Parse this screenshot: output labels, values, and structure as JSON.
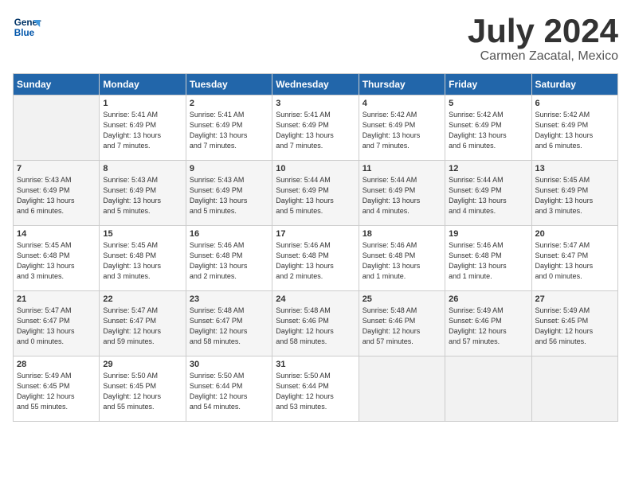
{
  "header": {
    "logo_line1": "General",
    "logo_line2": "Blue",
    "title": "July 2024",
    "subtitle": "Carmen Zacatal, Mexico"
  },
  "days_of_week": [
    "Sunday",
    "Monday",
    "Tuesday",
    "Wednesday",
    "Thursday",
    "Friday",
    "Saturday"
  ],
  "weeks": [
    [
      {
        "day": "",
        "info": ""
      },
      {
        "day": "1",
        "info": "Sunrise: 5:41 AM\nSunset: 6:49 PM\nDaylight: 13 hours\nand 7 minutes."
      },
      {
        "day": "2",
        "info": "Sunrise: 5:41 AM\nSunset: 6:49 PM\nDaylight: 13 hours\nand 7 minutes."
      },
      {
        "day": "3",
        "info": "Sunrise: 5:41 AM\nSunset: 6:49 PM\nDaylight: 13 hours\nand 7 minutes."
      },
      {
        "day": "4",
        "info": "Sunrise: 5:42 AM\nSunset: 6:49 PM\nDaylight: 13 hours\nand 7 minutes."
      },
      {
        "day": "5",
        "info": "Sunrise: 5:42 AM\nSunset: 6:49 PM\nDaylight: 13 hours\nand 6 minutes."
      },
      {
        "day": "6",
        "info": "Sunrise: 5:42 AM\nSunset: 6:49 PM\nDaylight: 13 hours\nand 6 minutes."
      }
    ],
    [
      {
        "day": "7",
        "info": "Sunrise: 5:43 AM\nSunset: 6:49 PM\nDaylight: 13 hours\nand 6 minutes."
      },
      {
        "day": "8",
        "info": "Sunrise: 5:43 AM\nSunset: 6:49 PM\nDaylight: 13 hours\nand 5 minutes."
      },
      {
        "day": "9",
        "info": "Sunrise: 5:43 AM\nSunset: 6:49 PM\nDaylight: 13 hours\nand 5 minutes."
      },
      {
        "day": "10",
        "info": "Sunrise: 5:44 AM\nSunset: 6:49 PM\nDaylight: 13 hours\nand 5 minutes."
      },
      {
        "day": "11",
        "info": "Sunrise: 5:44 AM\nSunset: 6:49 PM\nDaylight: 13 hours\nand 4 minutes."
      },
      {
        "day": "12",
        "info": "Sunrise: 5:44 AM\nSunset: 6:49 PM\nDaylight: 13 hours\nand 4 minutes."
      },
      {
        "day": "13",
        "info": "Sunrise: 5:45 AM\nSunset: 6:49 PM\nDaylight: 13 hours\nand 3 minutes."
      }
    ],
    [
      {
        "day": "14",
        "info": "Sunrise: 5:45 AM\nSunset: 6:48 PM\nDaylight: 13 hours\nand 3 minutes."
      },
      {
        "day": "15",
        "info": "Sunrise: 5:45 AM\nSunset: 6:48 PM\nDaylight: 13 hours\nand 3 minutes."
      },
      {
        "day": "16",
        "info": "Sunrise: 5:46 AM\nSunset: 6:48 PM\nDaylight: 13 hours\nand 2 minutes."
      },
      {
        "day": "17",
        "info": "Sunrise: 5:46 AM\nSunset: 6:48 PM\nDaylight: 13 hours\nand 2 minutes."
      },
      {
        "day": "18",
        "info": "Sunrise: 5:46 AM\nSunset: 6:48 PM\nDaylight: 13 hours\nand 1 minute."
      },
      {
        "day": "19",
        "info": "Sunrise: 5:46 AM\nSunset: 6:48 PM\nDaylight: 13 hours\nand 1 minute."
      },
      {
        "day": "20",
        "info": "Sunrise: 5:47 AM\nSunset: 6:47 PM\nDaylight: 13 hours\nand 0 minutes."
      }
    ],
    [
      {
        "day": "21",
        "info": "Sunrise: 5:47 AM\nSunset: 6:47 PM\nDaylight: 13 hours\nand 0 minutes."
      },
      {
        "day": "22",
        "info": "Sunrise: 5:47 AM\nSunset: 6:47 PM\nDaylight: 12 hours\nand 59 minutes."
      },
      {
        "day": "23",
        "info": "Sunrise: 5:48 AM\nSunset: 6:47 PM\nDaylight: 12 hours\nand 58 minutes."
      },
      {
        "day": "24",
        "info": "Sunrise: 5:48 AM\nSunset: 6:46 PM\nDaylight: 12 hours\nand 58 minutes."
      },
      {
        "day": "25",
        "info": "Sunrise: 5:48 AM\nSunset: 6:46 PM\nDaylight: 12 hours\nand 57 minutes."
      },
      {
        "day": "26",
        "info": "Sunrise: 5:49 AM\nSunset: 6:46 PM\nDaylight: 12 hours\nand 57 minutes."
      },
      {
        "day": "27",
        "info": "Sunrise: 5:49 AM\nSunset: 6:45 PM\nDaylight: 12 hours\nand 56 minutes."
      }
    ],
    [
      {
        "day": "28",
        "info": "Sunrise: 5:49 AM\nSunset: 6:45 PM\nDaylight: 12 hours\nand 55 minutes."
      },
      {
        "day": "29",
        "info": "Sunrise: 5:50 AM\nSunset: 6:45 PM\nDaylight: 12 hours\nand 55 minutes."
      },
      {
        "day": "30",
        "info": "Sunrise: 5:50 AM\nSunset: 6:44 PM\nDaylight: 12 hours\nand 54 minutes."
      },
      {
        "day": "31",
        "info": "Sunrise: 5:50 AM\nSunset: 6:44 PM\nDaylight: 12 hours\nand 53 minutes."
      },
      {
        "day": "",
        "info": ""
      },
      {
        "day": "",
        "info": ""
      },
      {
        "day": "",
        "info": ""
      }
    ]
  ]
}
